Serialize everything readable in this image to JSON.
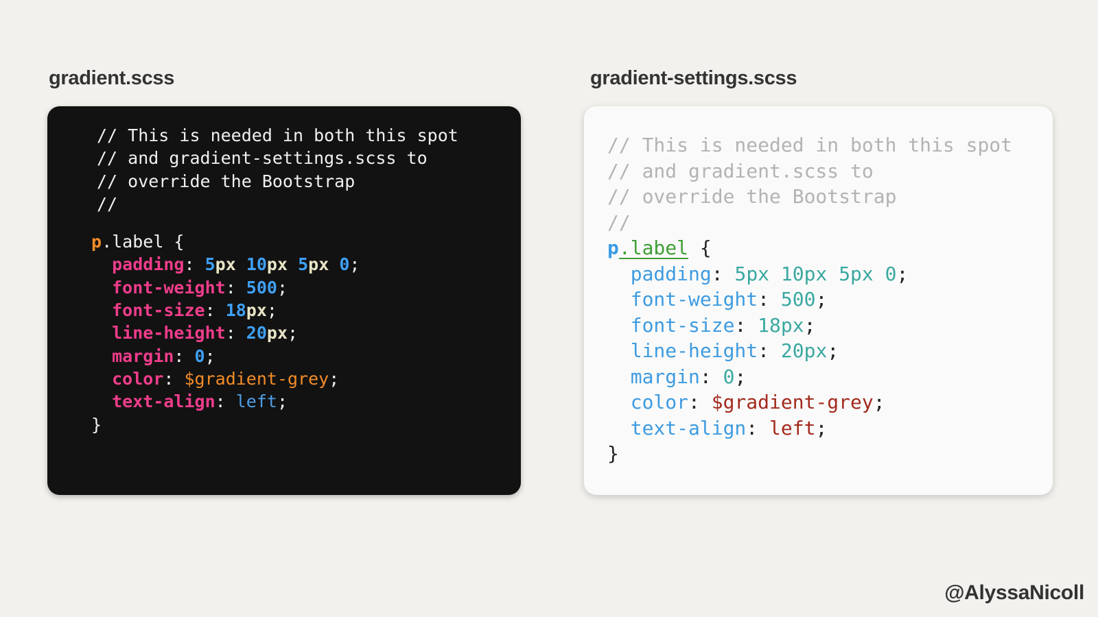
{
  "left": {
    "title": "gradient.scss",
    "comments": [
      "// This is needed in both this spot",
      "// and gradient-settings.scss to",
      "// override the Bootstrap",
      "//"
    ]
  },
  "right": {
    "title": "gradient-settings.scss",
    "comments": [
      "// This is needed in both this spot",
      "// and gradient.scss to",
      "// override the Bootstrap",
      "//"
    ]
  },
  "rule": {
    "selector_tag": "p",
    "selector_class": ".label",
    "open_brace": " {",
    "close_brace": "}",
    "declarations": [
      {
        "prop": "padding",
        "tokens": [
          {
            "t": "num",
            "v": "5"
          },
          {
            "t": "unit",
            "v": "px"
          },
          {
            "t": "punc",
            "v": " "
          },
          {
            "t": "num",
            "v": "10"
          },
          {
            "t": "unit",
            "v": "px"
          },
          {
            "t": "punc",
            "v": " "
          },
          {
            "t": "num",
            "v": "5"
          },
          {
            "t": "unit",
            "v": "px"
          },
          {
            "t": "punc",
            "v": " "
          },
          {
            "t": "num",
            "v": "0"
          }
        ]
      },
      {
        "prop": "font-weight",
        "tokens": [
          {
            "t": "num",
            "v": "500"
          }
        ]
      },
      {
        "prop": "font-size",
        "tokens": [
          {
            "t": "num",
            "v": "18"
          },
          {
            "t": "unit",
            "v": "px"
          }
        ]
      },
      {
        "prop": "line-height",
        "tokens": [
          {
            "t": "num",
            "v": "20"
          },
          {
            "t": "unit",
            "v": "px"
          }
        ]
      },
      {
        "prop": "margin",
        "tokens": [
          {
            "t": "num",
            "v": "0"
          }
        ]
      },
      {
        "prop": "color",
        "tokens": [
          {
            "t": "var",
            "v": "$gradient-grey"
          }
        ]
      },
      {
        "prop": "text-align",
        "tokens": [
          {
            "t": "kw",
            "v": "left"
          }
        ]
      }
    ]
  },
  "author": "@AlyssaNicoll",
  "colors": {
    "background": "#f2f1ed",
    "dark_panel": "#121212",
    "light_panel": "#fafafa",
    "dark_property": "#ee3d8b",
    "dark_number": "#3fa0f5",
    "dark_variable": "#f28c28",
    "light_property": "#3d9be0",
    "light_number": "#3aa89f",
    "light_variable": "#a32a1d",
    "light_class": "#3f9e34"
  }
}
